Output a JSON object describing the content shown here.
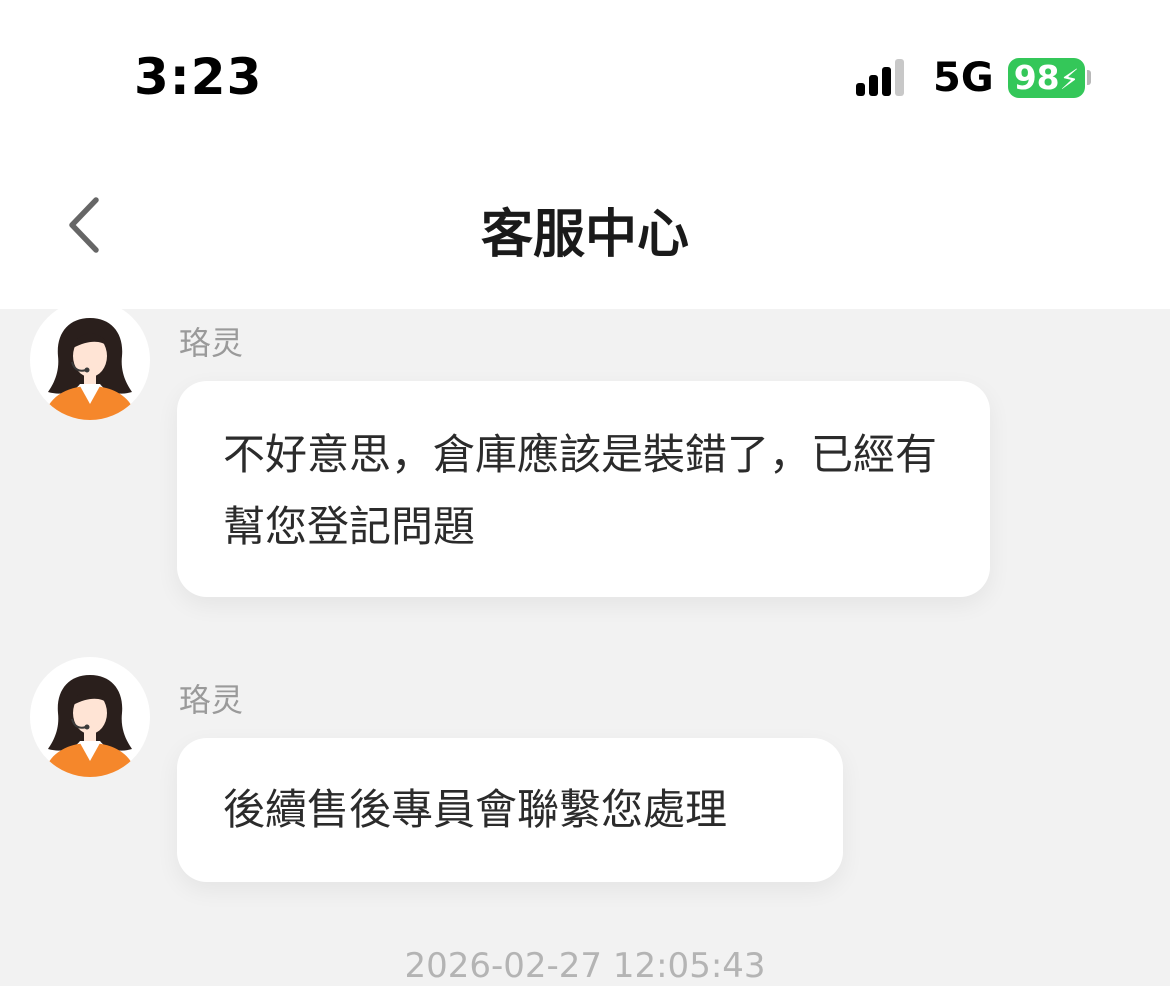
{
  "status_bar": {
    "time": "3:23",
    "network": "5G",
    "battery": "98"
  },
  "header": {
    "title": "客服中心",
    "back_icon": "chevron-left-icon"
  },
  "messages": [
    {
      "sender": "珞灵",
      "avatar_icon": "agent-avatar-icon",
      "text": "不好意思，倉庫應該是裝錯了，已經有幫您登記問題"
    },
    {
      "sender": "珞灵",
      "avatar_icon": "agent-avatar-icon",
      "text": "後續售後專員會聯繫您處理"
    }
  ],
  "timestamp": "2026-02-27 12:05:43",
  "colors": {
    "battery": "#34c759",
    "background": "#f2f2f2",
    "bubble": "#ffffff",
    "agent_jacket": "#f5872b"
  }
}
